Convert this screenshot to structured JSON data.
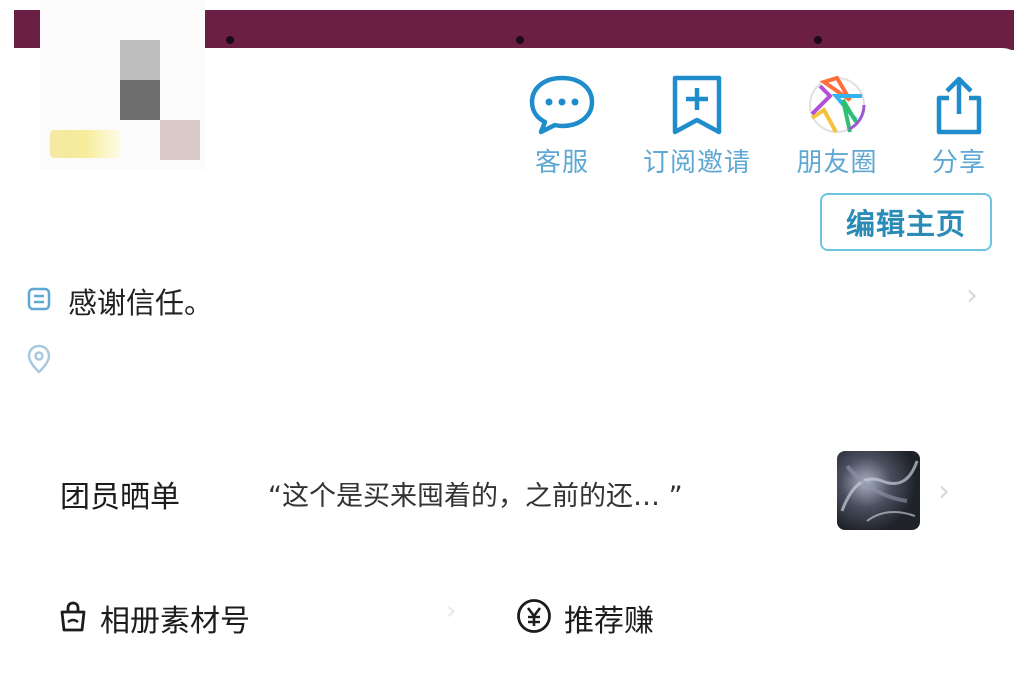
{
  "actions": [
    {
      "name": "customer-service",
      "icon": "chat-bubble-icon",
      "label": "客服"
    },
    {
      "name": "subscribe-invite",
      "icon": "bookmark-plus-icon",
      "label": "订阅邀请"
    },
    {
      "name": "moments",
      "icon": "camera-aperture-icon",
      "label": "朋友圈"
    },
    {
      "name": "share",
      "icon": "share-upload-icon",
      "label": "分享"
    }
  ],
  "edit_button": "编辑主页",
  "bio": {
    "icon": "note-icon",
    "text": "感谢信任。"
  },
  "location": {
    "icon": "location-pin-icon",
    "text": ""
  },
  "showcase": {
    "title": "团员晒单",
    "quote": "“这个是买来囤着的，之前的还…  ”"
  },
  "bottom": {
    "album": {
      "icon": "bag-icon",
      "label": "相册素材号"
    },
    "earn": {
      "icon": "yen-circle-icon",
      "label": "推荐赚"
    }
  },
  "colors": {
    "accent": "#2a8bb6",
    "icon_blue": "#1f8ccc",
    "banner": "#6b1f44"
  }
}
